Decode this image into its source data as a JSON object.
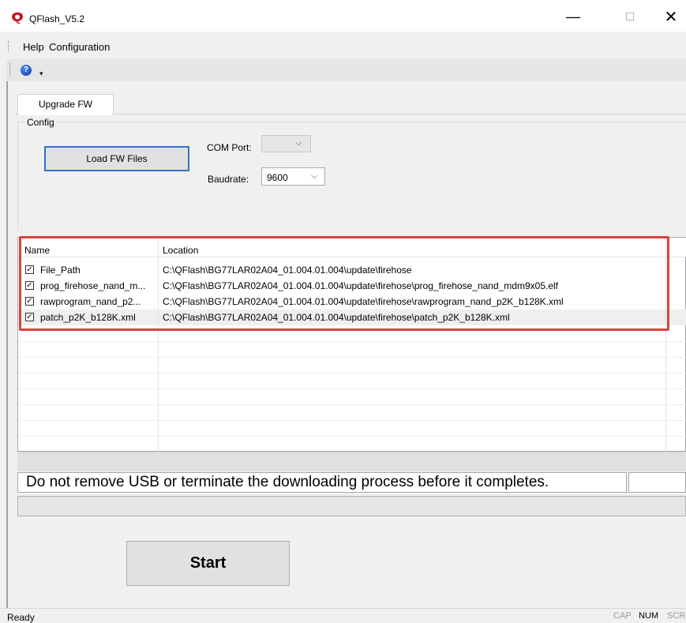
{
  "window": {
    "title": "QFlash_V5.2",
    "minimize_glyph": "—",
    "maximize_glyph": "☐",
    "close_glyph": "✕"
  },
  "menu": {
    "items": [
      "Help",
      "Configuration"
    ]
  },
  "toolbar": {
    "help_icon_glyph": "?",
    "overflow_glyph": "▾"
  },
  "tabs": [
    "Upgrade FW"
  ],
  "config": {
    "group_label": "Config",
    "load_button": "Load FW Files",
    "com_port_label": "COM Port:",
    "com_port_value": "",
    "baudrate_label": "Baudrate:",
    "baudrate_value": "9600",
    "chevron_glyph": "⌵"
  },
  "file_list": {
    "columns": [
      "Name",
      "Location"
    ],
    "rows": [
      {
        "checked": true,
        "name": "File_Path",
        "location": "C:\\QFlash\\BG77LAR02A04_01.004.01.004\\update\\firehose"
      },
      {
        "checked": true,
        "name": "prog_firehose_nand_m...",
        "location": "C:\\QFlash\\BG77LAR02A04_01.004.01.004\\update\\firehose\\prog_firehose_nand_mdm9x05.elf"
      },
      {
        "checked": true,
        "name": "rawprogram_nand_p2...",
        "location": "C:\\QFlash\\BG77LAR02A04_01.004.01.004\\update\\firehose\\rawprogram_nand_p2K_b128K.xml"
      },
      {
        "checked": true,
        "name": "patch_p2K_b128K.xml",
        "location": "C:\\QFlash\\BG77LAR02A04_01.004.01.004\\update\\firehose\\patch_p2K_b128K.xml"
      }
    ]
  },
  "warning": "Do not remove USB or terminate the downloading process before it completes.",
  "start_button": "Start",
  "statusbar": {
    "status": "Ready",
    "indicators": [
      "CAP",
      "NUM",
      "SCRL"
    ]
  },
  "colors": {
    "highlight": "#d9433f",
    "focus_border": "#2b73cc"
  }
}
